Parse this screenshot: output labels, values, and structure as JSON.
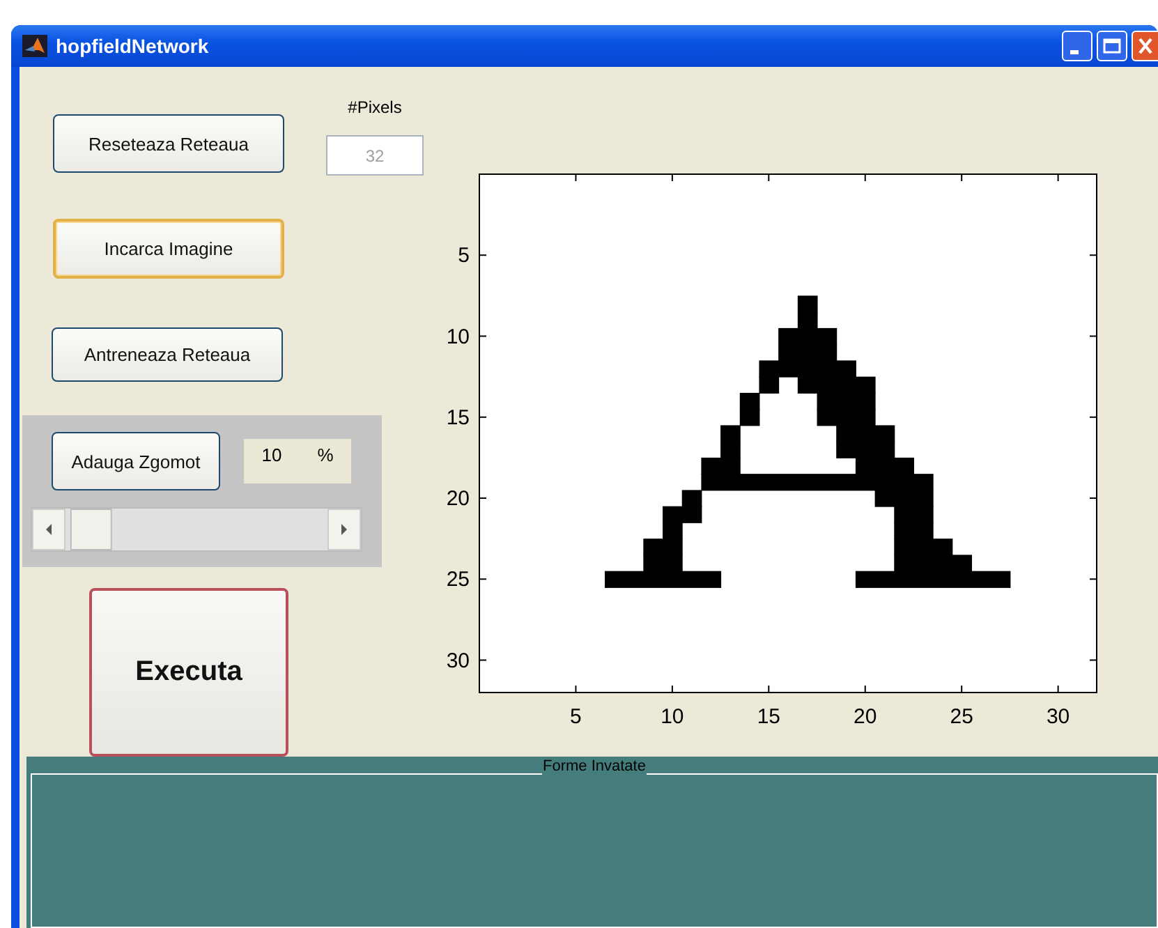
{
  "window": {
    "title": "hopfieldNetwork"
  },
  "buttons": [
    {
      "label": "Reseteaza Reteaua",
      "focused": false
    },
    {
      "label": "Incarca Imagine",
      "focused": true
    },
    {
      "label": "Antreneaza Reteaua",
      "focused": false
    }
  ],
  "pixels": {
    "label": "#Pixels",
    "value": "32",
    "disabled": true
  },
  "noise": {
    "button": "Adauga Zgomot",
    "value": "10",
    "unit": "%",
    "level": 0.02
  },
  "execute": {
    "label": "Executa",
    "focused": true
  },
  "axes": {
    "xticks": [
      "5",
      "10",
      "15",
      "20",
      "25",
      "30"
    ],
    "yticks": [
      "5",
      "10",
      "15",
      "20",
      "25",
      "30"
    ]
  },
  "panel": {
    "title": "Forme Invatate"
  }
}
